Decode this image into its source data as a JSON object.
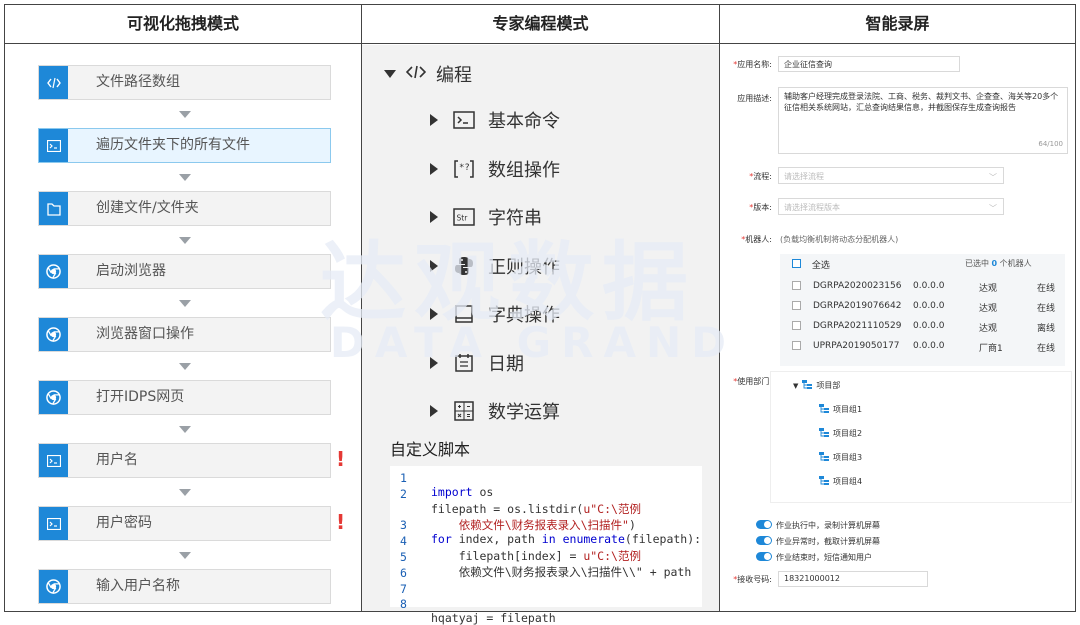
{
  "headers": {
    "col1": "可视化拖拽模式",
    "col2": "专家编程模式",
    "col3": "智能录屏"
  },
  "flow": {
    "nodes": [
      {
        "icon": "code-icon",
        "label": "文件路径数组",
        "selected": false,
        "warning": false
      },
      {
        "icon": "terminal-icon",
        "label": "遍历文件夹下的所有文件",
        "selected": true,
        "warning": false
      },
      {
        "icon": "file-icon",
        "label": "创建文件/文件夹",
        "selected": false,
        "warning": false
      },
      {
        "icon": "chrome-icon",
        "label": "启动浏览器",
        "selected": false,
        "warning": false
      },
      {
        "icon": "chrome-icon",
        "label": "浏览器窗口操作",
        "selected": false,
        "warning": false
      },
      {
        "icon": "chrome-icon",
        "label": "打开IDPS网页",
        "selected": false,
        "warning": false
      },
      {
        "icon": "terminal-icon",
        "label": "用户名",
        "selected": false,
        "warning": true
      },
      {
        "icon": "terminal-icon",
        "label": "用户密码",
        "selected": false,
        "warning": true
      },
      {
        "icon": "chrome-icon",
        "label": "输入用户名称",
        "selected": false,
        "warning": false
      }
    ],
    "warning_mark": "!"
  },
  "expert": {
    "root": {
      "icon": "code-icon",
      "label": "编程"
    },
    "items": [
      {
        "icon": "terminal-icon",
        "label": "基本命令"
      },
      {
        "icon": "array-icon",
        "label": "数组操作"
      },
      {
        "icon": "string-icon",
        "label": "字符串"
      },
      {
        "icon": "python-icon",
        "label": "正则操作"
      },
      {
        "icon": "book-icon",
        "label": "字典操作"
      },
      {
        "icon": "calendar-icon",
        "label": "日期"
      },
      {
        "icon": "calculator-icon",
        "label": "数学运算"
      }
    ],
    "script_title": "自定义脚本",
    "code": [
      {
        "n": "1",
        "text": "import os"
      },
      {
        "n": "2",
        "text": "filepath = os.listdir(u\"C:\\范例"
      },
      {
        "n": "",
        "text": "    依赖文件\\财务报表录入\\扫描件\")"
      },
      {
        "n": "3",
        "text": "for index, path in enumerate(filepath):"
      },
      {
        "n": "4",
        "text": "    filepath[index] = u\"C:\\范例"
      },
      {
        "n": "5",
        "text": "    依赖文件\\财务报表录入\\扫描件\\\\\" + path"
      },
      {
        "n": "6",
        "text": ""
      },
      {
        "n": "7",
        "text": ""
      },
      {
        "n": "8",
        "text": "hqatyaj = filepath"
      }
    ]
  },
  "watermark": {
    "cn": "达观数据",
    "en": "DATA GRAND"
  },
  "recorder": {
    "app_name_label": "应用名称:",
    "app_name_value": "企业征信查询",
    "desc_label": "应用描述:",
    "desc_value": "辅助客户经理完成登录法院、工商、税务、裁判文书、企查查、海关等20多个征信相关系统网站，汇总查询结果信息，并截图保存生成查询报告",
    "desc_count": "64/100",
    "flow_label": "流程:",
    "flow_placeholder": "请选择流程",
    "version_label": "版本:",
    "version_placeholder": "请选择流程版本",
    "robot_label": "机器人:",
    "robot_hint": "(负载均衡机制将动态分配机器人)",
    "select_all": "全选",
    "selected_prefix": "已选中",
    "selected_count": "0",
    "selected_suffix": "个机器人",
    "robots": [
      {
        "id": "DGRPA2020023156",
        "ip": "0.0.0.0",
        "owner": "达观",
        "status": "在线"
      },
      {
        "id": "DGRPA2019076642",
        "ip": "0.0.0.0",
        "owner": "达观",
        "status": "在线"
      },
      {
        "id": "DGRPA2021110529",
        "ip": "0.0.0.0",
        "owner": "达观",
        "status": "离线"
      },
      {
        "id": "UPRPA2019050177",
        "ip": "0.0.0.0",
        "owner": "厂商1",
        "status": "在线"
      }
    ],
    "dept_label": "使用部门:",
    "dept_root": "项目部",
    "dept_children": [
      "项目组1",
      "项目组2",
      "项目组3",
      "项目组4"
    ],
    "toggles": [
      "作业执行中，录制计算机屏幕",
      "作业异常时，截取计算机屏幕",
      "作业结束时，短信通知用户"
    ],
    "phone_label": "接收号码:",
    "phone_value": "18321000012",
    "required_mark": "*"
  }
}
